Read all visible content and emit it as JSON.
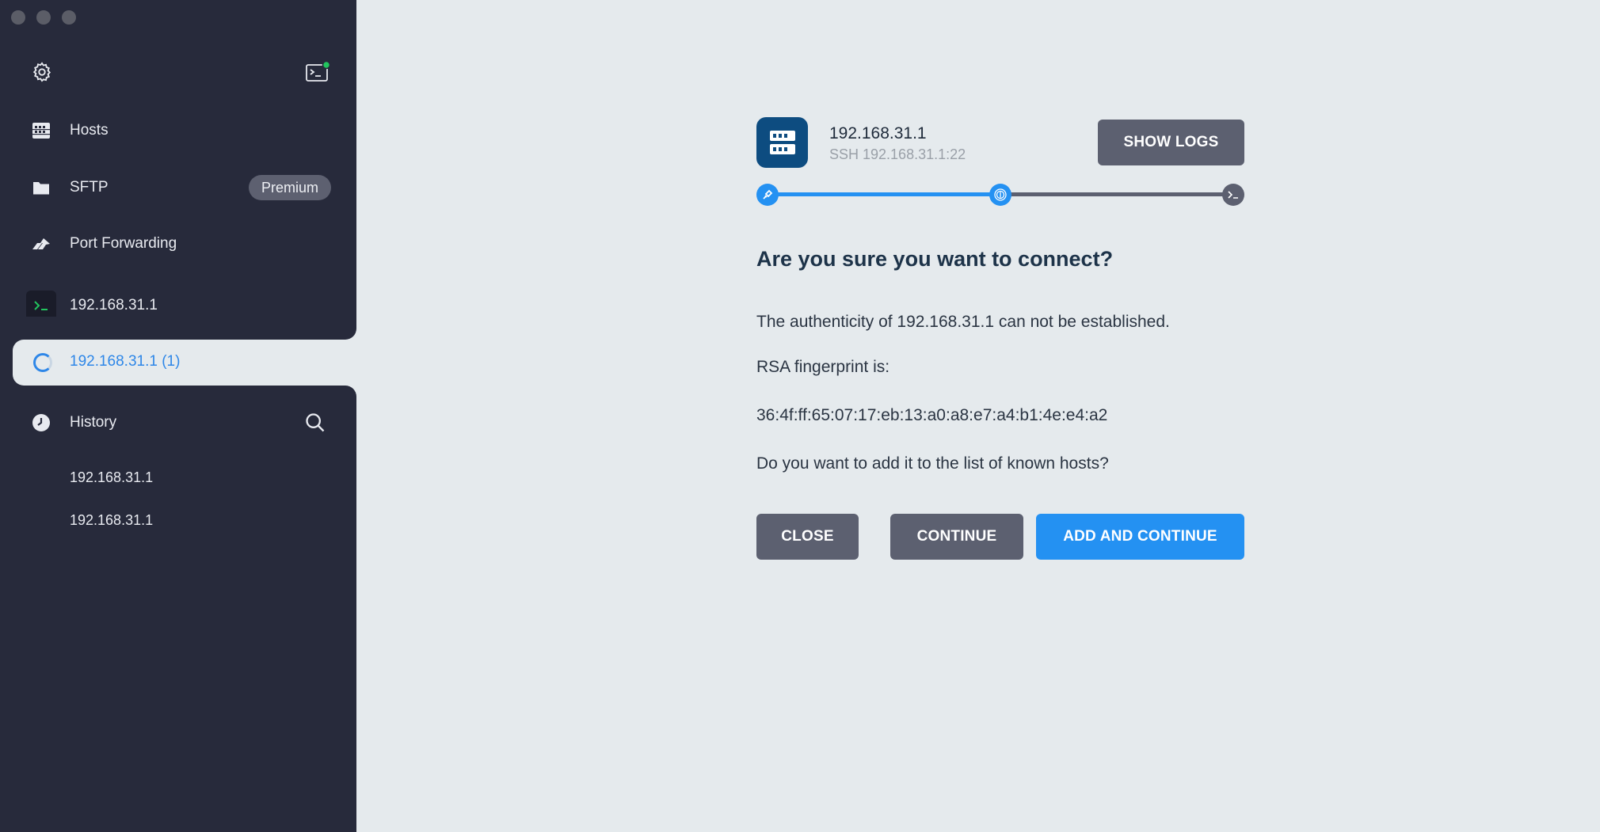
{
  "sidebar": {
    "nav": {
      "hosts": "Hosts",
      "sftp": "SFTP",
      "sftp_badge": "Premium",
      "port_forwarding": "Port Forwarding"
    },
    "sessions": [
      {
        "label": "192.168.31.1"
      },
      {
        "label": "192.168.31.1 (1)",
        "active": true
      }
    ],
    "history": {
      "label": "History",
      "entries": [
        "192.168.31.1",
        "192.168.31.1"
      ]
    }
  },
  "connection": {
    "host_name": "192.168.31.1",
    "host_sub": "SSH 192.168.31.1:22",
    "show_logs": "SHOW LOGS",
    "steps": [
      "connect-icon",
      "fingerprint-icon",
      "terminal-icon"
    ],
    "progress_step": 2,
    "heading": "Are you sure you want to connect?",
    "authenticity": "The authenticity of 192.168.31.1 can not be established.",
    "fingerprint_label": "RSA fingerprint is:",
    "fingerprint": "36:4f:ff:65:07:17:eb:13:a0:a8:e7:a4:b1:4e:e4:a2",
    "question": "Do you want to add it to the list of known hosts?",
    "buttons": {
      "close": "CLOSE",
      "continue": "CONTINUE",
      "add_continue": "ADD AND CONTINUE"
    }
  },
  "colors": {
    "sidebar_bg": "#272a3b",
    "main_bg": "#e5eaed",
    "accent": "#2491f2",
    "button_gray": "#5c6070",
    "status_green": "#22c55e"
  }
}
